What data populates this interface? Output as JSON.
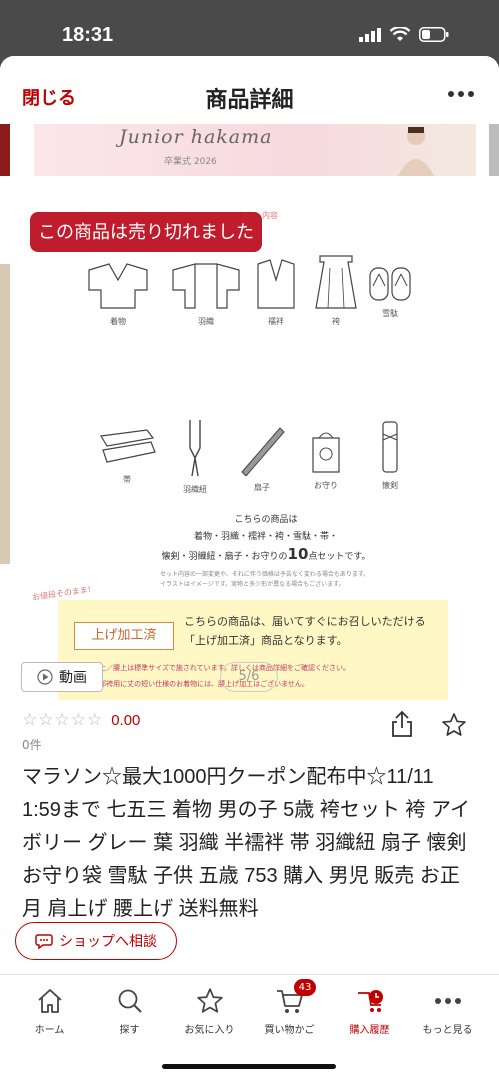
{
  "status_bar": {
    "time": "18:31"
  },
  "header": {
    "close_label": "閉じる",
    "title": "商品詳細"
  },
  "gallery": {
    "banner_title": "Junior hakama",
    "banner_sub": "卒業式 2026",
    "soldout_label": "この商品は売り切れました",
    "set_label": "セット内容",
    "items": [
      {
        "icon": "kimono-icon",
        "name": "着物"
      },
      {
        "icon": "haori-icon",
        "name": "羽織"
      },
      {
        "icon": "juban-icon",
        "name": "襦袢"
      },
      {
        "icon": "hakama-icon",
        "name": "袴"
      },
      {
        "icon": "setta-icon",
        "name": "雪駄"
      },
      {
        "icon": "obi-icon",
        "name": "帯"
      },
      {
        "icon": "haori-himo-icon",
        "name": "羽織紐"
      },
      {
        "icon": "sensu-icon",
        "name": "扇子"
      },
      {
        "icon": "omamori-icon",
        "name": "お守り"
      },
      {
        "icon": "kaiken-icon",
        "name": "懐剣"
      }
    ],
    "info_line1": "こちらの商品は",
    "info_line2": "着物・羽織・襦袢・袴・雪駄・帯・",
    "info_line3_prefix": "懐剣・羽織紐・扇子・お守りの",
    "info_line3_count": "10",
    "info_line3_suffix": "点セットです。",
    "info_note": "セット内容の一部変更や、それに伴う価格は予告なく変わる場合もあります。イラストはイメージです。実物と多少形が異なる場合もございます。",
    "price_label": "お値段そのまま!",
    "processed_label": "上げ加工済",
    "processed_desc_1": "こちらの商品は、届いてすぐにお召しいただける",
    "processed_desc_2": "「上げ加工済」商品となります。",
    "note_1": "●肩上／腰上は標準サイズで施されています。詳しくは商品詳細をご確認ください。",
    "note_2": "●一部袴用に丈の短い仕様のお着物には、腰上げ加工はございません。",
    "video_label": "動画",
    "counter": "5/6"
  },
  "product": {
    "stars": "☆☆☆☆☆",
    "rating": "0.00",
    "review_count": "0件",
    "title": "マラソン☆最大1000円クーポン配布中☆11/11 1:59まで 七五三 着物 男の子 5歳 袴セット 袴 アイボリー グレー 葉 羽織 半襦袢 帯 羽織紐 扇子 懐剣 お守り袋 雪駄 子供 五歳 753 購入 男児 販売 お正月 肩上げ 腰上げ 送料無料"
  },
  "consult_label": "ショップへ相談",
  "tabs": [
    {
      "label": "ホーム",
      "icon": "home-icon"
    },
    {
      "label": "探す",
      "icon": "search-icon"
    },
    {
      "label": "お気に入り",
      "icon": "star-icon"
    },
    {
      "label": "買い物かご",
      "icon": "cart-icon",
      "badge": "43"
    },
    {
      "label": "購入履歴",
      "icon": "purchase-history-icon"
    },
    {
      "label": "もっと見る",
      "icon": "more-icon"
    }
  ],
  "colors": {
    "accent": "#bf0000",
    "soldout": "#bf1d2d",
    "status_bg": "#4a4a4a"
  }
}
